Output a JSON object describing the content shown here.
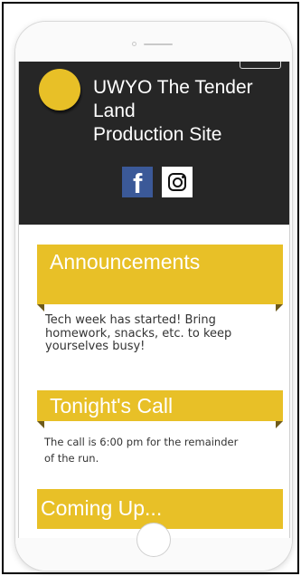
{
  "header": {
    "title": "UWYO The Tender\nLand\nProduction Site",
    "social": [
      {
        "name": "facebook",
        "icon": "facebook-icon",
        "glyph": "f"
      },
      {
        "name": "instagram",
        "icon": "instagram-icon"
      }
    ],
    "menu_icon": "menu-icon"
  },
  "sections": [
    {
      "title": "Announcements",
      "text": "Tech week has started! Bring\nhomework, snacks, etc. to keep\nyourselves busy!"
    },
    {
      "title": "Tonight's Call",
      "text": "The call is 6:00 pm for the remainder\nof the run."
    },
    {
      "title": "Coming Up...",
      "text": ""
    }
  ],
  "colors": {
    "header_bg": "#262626",
    "accent_yellow": "#e8c027",
    "facebook_blue": "#3b5998",
    "fold_shadow": "#6e5a1a"
  }
}
